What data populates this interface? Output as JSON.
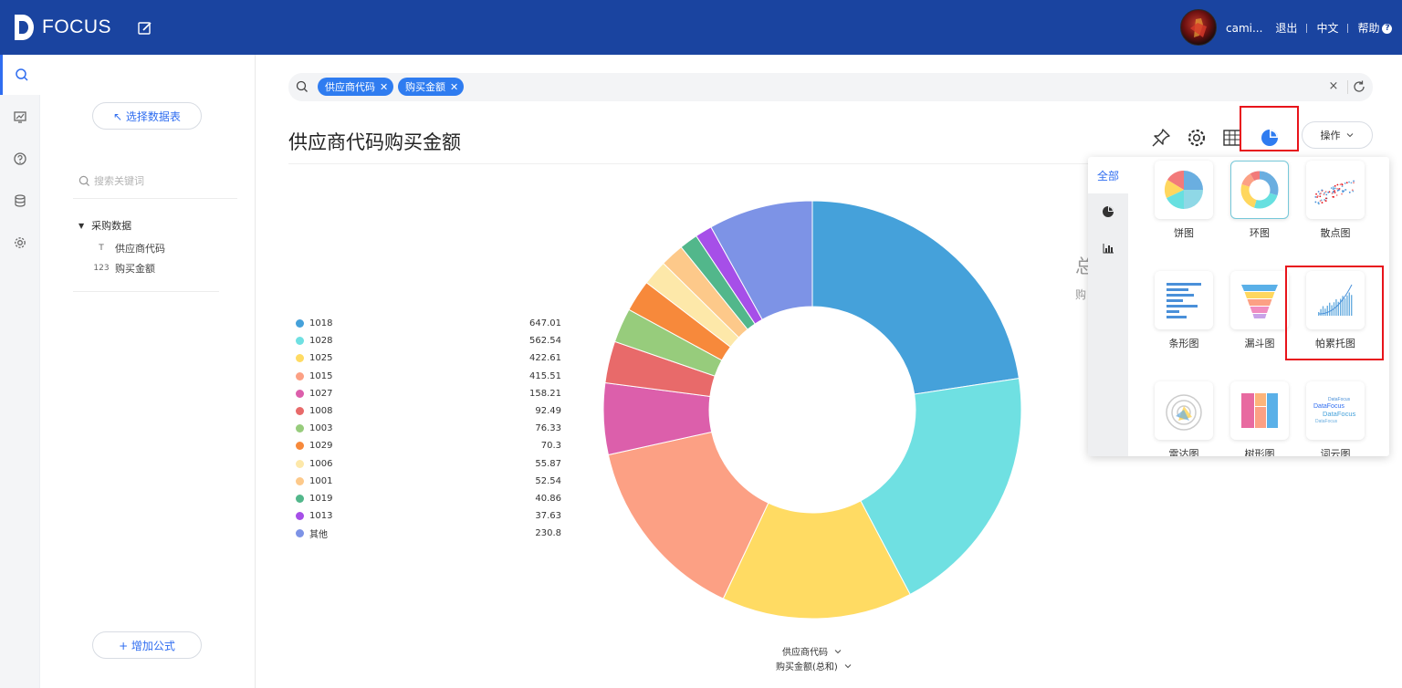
{
  "header": {
    "logo_text": "FOCUS",
    "username": "cami...",
    "links": {
      "logout": "退出",
      "language": "中文",
      "help": "帮助"
    },
    "help_mark": "?"
  },
  "panel": {
    "select_table": "↖ 选择数据表",
    "search_placeholder": "搜索关键词",
    "tree": {
      "root": "采购数据",
      "items": [
        {
          "type_mark": "T",
          "label": "供应商代码"
        },
        {
          "type_mark": "123",
          "label": "购买金额"
        }
      ]
    },
    "add_formula": "+ 增加公式"
  },
  "search": {
    "tags": [
      {
        "label": "供应商代码"
      },
      {
        "label": "购买金额"
      }
    ],
    "clear": "×"
  },
  "page_title": "供应商代码购买金额",
  "toolbar": {
    "ops_label": "操作"
  },
  "hidden_stat": {
    "big": "总",
    "small": "购"
  },
  "chart_data": {
    "type": "pie",
    "donut": true,
    "categories": [
      "1018",
      "1028",
      "1025",
      "1015",
      "1027",
      "1008",
      "1003",
      "1029",
      "1006",
      "1001",
      "1019",
      "1013",
      "其他"
    ],
    "values": [
      647.01,
      562.54,
      422.61,
      415.51,
      158.21,
      92.49,
      76.33,
      70.3,
      55.87,
      52.54,
      40.86,
      37.63,
      230.8
    ],
    "value_labels": [
      "647.01",
      "562.54",
      "422.61",
      "415.51",
      "158.21",
      "92.49",
      "76.33",
      "70.3",
      "55.87",
      "52.54",
      "40.86",
      "37.63",
      "230.8"
    ],
    "colors": [
      "#45a1da",
      "#6fe0e2",
      "#ffdb63",
      "#fca084",
      "#dc5fab",
      "#e86a6a",
      "#97cc7c",
      "#f7893b",
      "#fde8a9",
      "#fdc98a",
      "#52b78b",
      "#a64fe8",
      "#7d93e6"
    ],
    "legend_position": "left",
    "x_selector": "供应商代码",
    "y_selector": "购买金额(总和)"
  },
  "chart_menu": {
    "categories": [
      {
        "label": "全部"
      }
    ],
    "types": [
      {
        "label": "饼图",
        "icon": "pie-chart-icon"
      },
      {
        "label": "环图",
        "icon": "donut-chart-icon",
        "selected": true
      },
      {
        "label": "散点图",
        "icon": "scatter-chart-icon"
      },
      {
        "label": "条形图",
        "icon": "bar-chart-icon"
      },
      {
        "label": "漏斗图",
        "icon": "funnel-chart-icon"
      },
      {
        "label": "帕累托图",
        "icon": "pareto-chart-icon"
      },
      {
        "label": "雷达图",
        "icon": "radar-chart-icon"
      },
      {
        "label": "树形图",
        "icon": "treemap-chart-icon"
      },
      {
        "label": "词云图",
        "icon": "word-cloud-chart-icon"
      }
    ],
    "wordcloud_logo_text": "DataFocus"
  }
}
